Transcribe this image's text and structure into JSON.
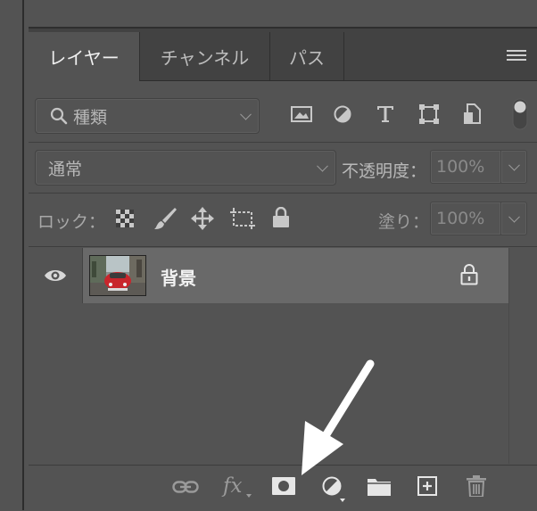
{
  "tabs": [
    {
      "label": "レイヤー",
      "active": true
    },
    {
      "label": "チャンネル",
      "active": false
    },
    {
      "label": "パス",
      "active": false
    }
  ],
  "filter": {
    "placeholder": "種類",
    "icons": [
      "image-filter-icon",
      "adjustment-filter-icon",
      "type-filter-icon",
      "shape-filter-icon",
      "smart-object-filter-icon"
    ]
  },
  "blend": {
    "mode": "通常",
    "opacity_label": "不透明度：",
    "opacity_value": "100%"
  },
  "lock": {
    "label": "ロック：",
    "fill_label": "塗り：",
    "fill_value": "100%"
  },
  "layers": [
    {
      "name": "背景",
      "visible": true,
      "locked": true
    }
  ],
  "bottom_toolbar": {
    "fx_label": "fx"
  },
  "colors": {
    "panel_bg": "#535353",
    "selected_row": "#696969",
    "tab_bar": "#424242",
    "annotation_arrow": "#ffffff"
  }
}
